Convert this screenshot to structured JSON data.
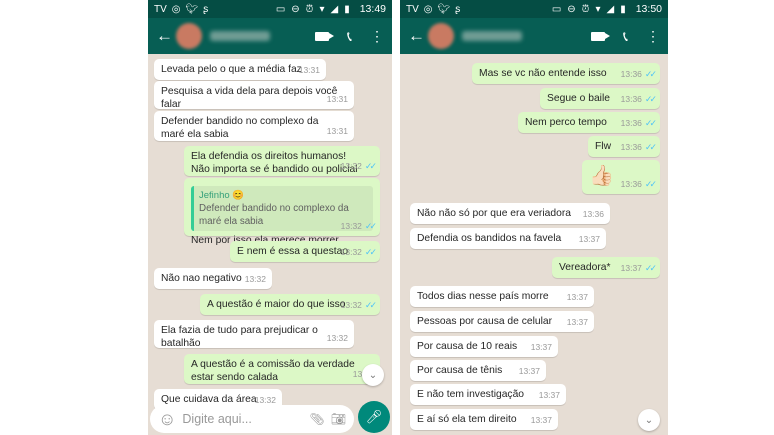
{
  "left": {
    "status": {
      "time": "13:49",
      "left_icons": [
        "TV",
        "whatsapp-icon",
        "twitter-icon",
        "shazam-icon"
      ]
    },
    "composer": {
      "placeholder": "Digite aqui..."
    },
    "messages": [
      {
        "text": "Levada pelo o que a média faz",
        "time": "13:31"
      },
      {
        "text": "Pesquisa a vida dela para depois você falar",
        "time": "13:31"
      },
      {
        "text": "Defender bandido no complexo da maré ela sabia",
        "time": "13:31"
      },
      {
        "text": "Ela defendia os direitos humanos! Não importa se é bandido ou policial",
        "time": "13:32"
      },
      {
        "quote_name": "Jefinho",
        "quote_text": "Defender bandido no complexo da maré ela sabia",
        "text": "Nem por isso ela merece morrer",
        "time": "13:32"
      },
      {
        "text": "E nem é essa a questao",
        "time": "13:32"
      },
      {
        "text": "Não nao negativo",
        "time": "13:32"
      },
      {
        "text": "A questão é maior do que isso",
        "time": "13:32"
      },
      {
        "text": "Ela fazia de tudo para prejudicar o batalhão",
        "time": "13:32"
      },
      {
        "text": "A questão é a comissão da verdade estar sendo calada",
        "time": "13:32"
      },
      {
        "text": "Que cuidava da área",
        "time": "13:32"
      }
    ]
  },
  "right": {
    "status": {
      "time": "13:50",
      "left_icons": [
        "TV",
        "whatsapp-icon",
        "twitter-icon",
        "shazam-icon"
      ]
    },
    "messages": [
      {
        "text": "Mas se vc não entende isso",
        "time": "13:36"
      },
      {
        "text": "Segue o baile",
        "time": "13:36"
      },
      {
        "text": "Nem perco tempo",
        "time": "13:36"
      },
      {
        "text": "Flw",
        "time": "13:36"
      },
      {
        "emoji": "👍🏻",
        "time": "13:36"
      },
      {
        "text": "Não não só por que era veriadora",
        "time": "13:36"
      },
      {
        "text": "Defendia os bandidos na favela",
        "time": "13:37"
      },
      {
        "text": "Vereadora*",
        "time": "13:37"
      },
      {
        "text": "Todos dias nesse país morre",
        "time": "13:37"
      },
      {
        "text": "Pessoas por causa de celular",
        "time": "13:37"
      },
      {
        "text": "Por causa de 10 reais",
        "time": "13:37"
      },
      {
        "text": "Por causa de tênis",
        "time": "13:37"
      },
      {
        "text": "E não tem investigação",
        "time": "13:37"
      },
      {
        "text": "E aí só ela tem direito",
        "time": "13:37"
      }
    ]
  },
  "colors": {
    "header": "#075e54",
    "statusbar": "#054d44",
    "outgoing": "#dcf8c6",
    "incoming": "#ffffff",
    "chat_bg": "#e6ddd4",
    "read_ticks": "#4fc3f7",
    "fab": "#00897b"
  }
}
